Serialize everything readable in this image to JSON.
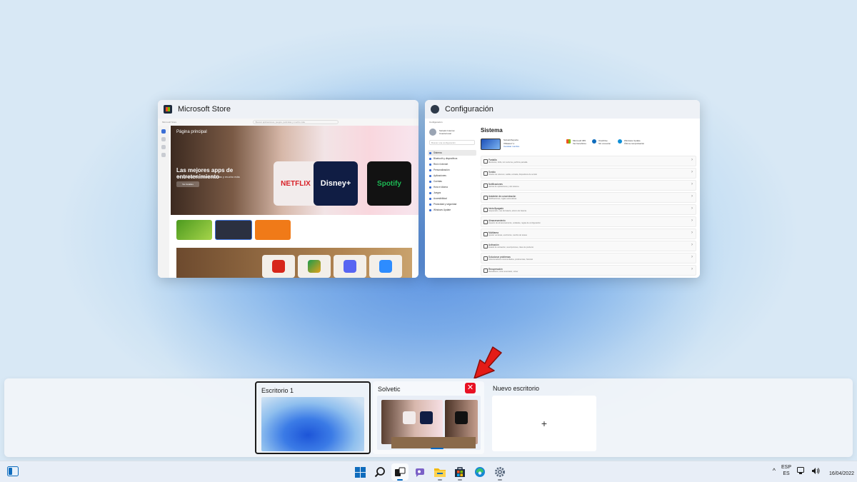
{
  "windows": {
    "store": {
      "title": "Microsoft Store",
      "search_placeholder": "Buscar aplicaciones, juegos, películas y mucho más",
      "app_label": "Microsoft Store",
      "hero_label": "Página principal",
      "hero_headline": "Las mejores apps de entretenimiento",
      "hero_sub": "Tus películas, TV y música favoritas y mucho más",
      "hero_button": "Ver detalles",
      "tiles": [
        "NETFLIX",
        "Disney+",
        "Spotify"
      ]
    },
    "settings": {
      "title": "Configuración",
      "breadcrumb": "Configuración",
      "user_name": "Solvetic Internet",
      "user_sub": "Cuenta local",
      "search_placeholder": "Buscar una configuración",
      "nav": [
        "Sistema",
        "Bluetooth y dispositivos",
        "Red e Internet",
        "Personalización",
        "Aplicaciones",
        "Cuentas",
        "Hora e idioma",
        "Juegos",
        "Accesibilidad",
        "Privacidad y seguridad",
        "Windows Update"
      ],
      "page_title": "Sistema",
      "device_name": "SolveticSoporte",
      "device_sub": "VMware7,1",
      "device_link": "Cambiar nombre",
      "quick": [
        {
          "title": "Microsoft 365",
          "sub": "Ver beneficios"
        },
        {
          "title": "OneDrive",
          "sub": "Sin conexión"
        },
        {
          "title": "Windows Update",
          "sub": "Última comprobación"
        }
      ],
      "rows": [
        {
          "title": "Pantalla",
          "sub": "Monitores, brillo, luz nocturna, perfil de pantalla"
        },
        {
          "title": "Sonido",
          "sub": "Niveles de volumen, salida, entrada, dispositivos de sonido"
        },
        {
          "title": "Notificaciones",
          "sub": "Alertas de aplicaciones y del sistema"
        },
        {
          "title": "Asistente de concentración",
          "sub": "Notificaciones, reglas automáticas"
        },
        {
          "title": "Inicio/Apagado",
          "sub": "Suspensión, uso de batería, ahorro de batería"
        },
        {
          "title": "Almacenamiento",
          "sub": "Espacio de almacenamiento, unidades, reglas de configuración"
        },
        {
          "title": "Multitarea",
          "sub": "Ajustar ventanas, escritorios, cambio de tareas"
        },
        {
          "title": "Activación",
          "sub": "Estado de activación, suscripciones, clave de producto"
        },
        {
          "title": "Solucionar problemas",
          "sub": "Solucionadores recomendados, preferencias, historial"
        },
        {
          "title": "Recuperación",
          "sub": "Restablecer, inicio avanzado, volver"
        }
      ]
    }
  },
  "desktops": {
    "desk1_label": "Escritorio 1",
    "desk2_label": "Solvetic",
    "new_label": "Nuevo escritorio",
    "new_plus": "+",
    "close_glyph": "✕"
  },
  "taskbar": {
    "lang_top": "ESP",
    "lang_bottom": "ES",
    "date": "16/04/2022",
    "chevron": "^"
  },
  "colors": {
    "accent": "#0067c0",
    "close_red": "#e81123",
    "arrow_red": "#e41b17"
  }
}
